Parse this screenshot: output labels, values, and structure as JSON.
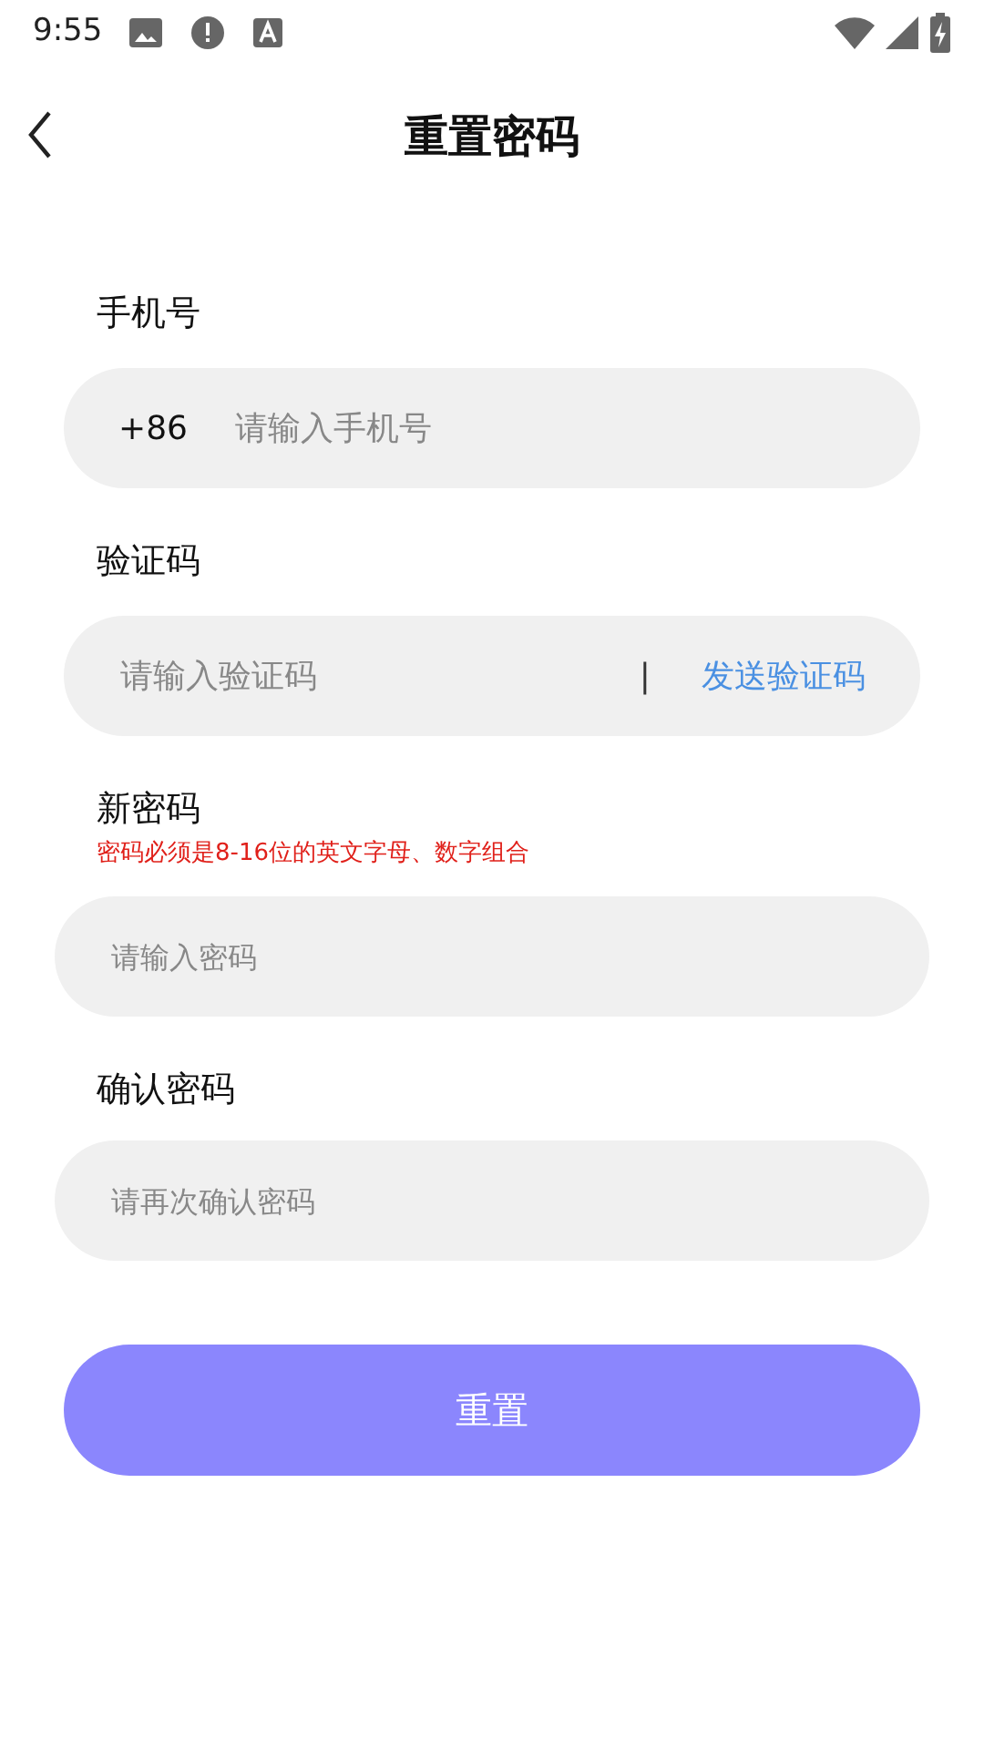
{
  "status_bar": {
    "time": "9:55"
  },
  "header": {
    "title": "重置密码"
  },
  "form": [
    {
      "kind": "phone",
      "label": "手机号",
      "prefix": "+86",
      "placeholder": "请输入手机号"
    },
    {
      "kind": "code",
      "label": "验证码",
      "placeholder": "请输入验证码",
      "separator": "|",
      "action": "发送验证码"
    },
    {
      "kind": "password",
      "label": "新密码",
      "hint": "密码必须是8-16位的英文字母、数字组合",
      "placeholder": "请输入密码"
    },
    {
      "kind": "password",
      "label": "确认密码",
      "placeholder": "请再次确认密码"
    }
  ],
  "submit": {
    "label": "重置"
  }
}
